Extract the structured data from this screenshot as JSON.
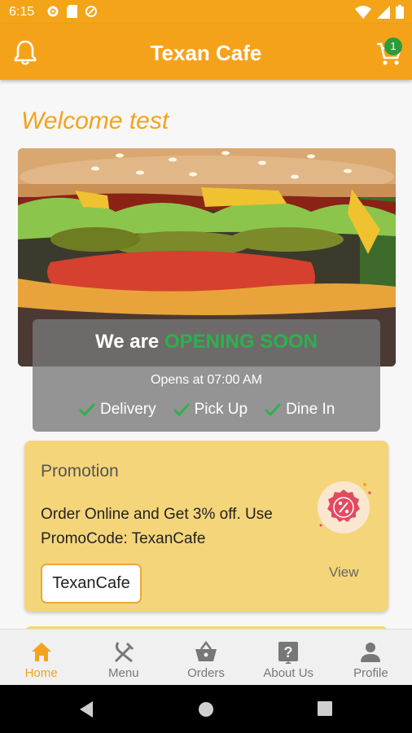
{
  "status_bar": {
    "time": "6:15"
  },
  "app_bar": {
    "title": "Texan Cafe",
    "cart_count": "1"
  },
  "welcome": "Welcome test",
  "banner": {
    "prefix": "We are",
    "highlight": "OPENING SOON",
    "opens_at": "Opens at 07:00 AM",
    "services": [
      "Delivery",
      "Pick Up",
      "Dine In"
    ]
  },
  "promotion": {
    "title": "Promotion",
    "description": "Order Online and Get 3% off. Use PromoCode: TexanCafe",
    "code": "TexanCafe",
    "view_label": "View"
  },
  "bottom_nav": {
    "items": [
      {
        "label": "Home",
        "icon": "home-icon"
      },
      {
        "label": "Menu",
        "icon": "fork-knife-icon"
      },
      {
        "label": "Orders",
        "icon": "basket-icon"
      },
      {
        "label": "About Us",
        "icon": "help-icon"
      },
      {
        "label": "Profile",
        "icon": "person-icon"
      }
    ],
    "active": "Home"
  },
  "colors": {
    "primary": "#f5a21b",
    "promo_bg": "#f5d57a",
    "accent_green": "#2bb24c"
  }
}
